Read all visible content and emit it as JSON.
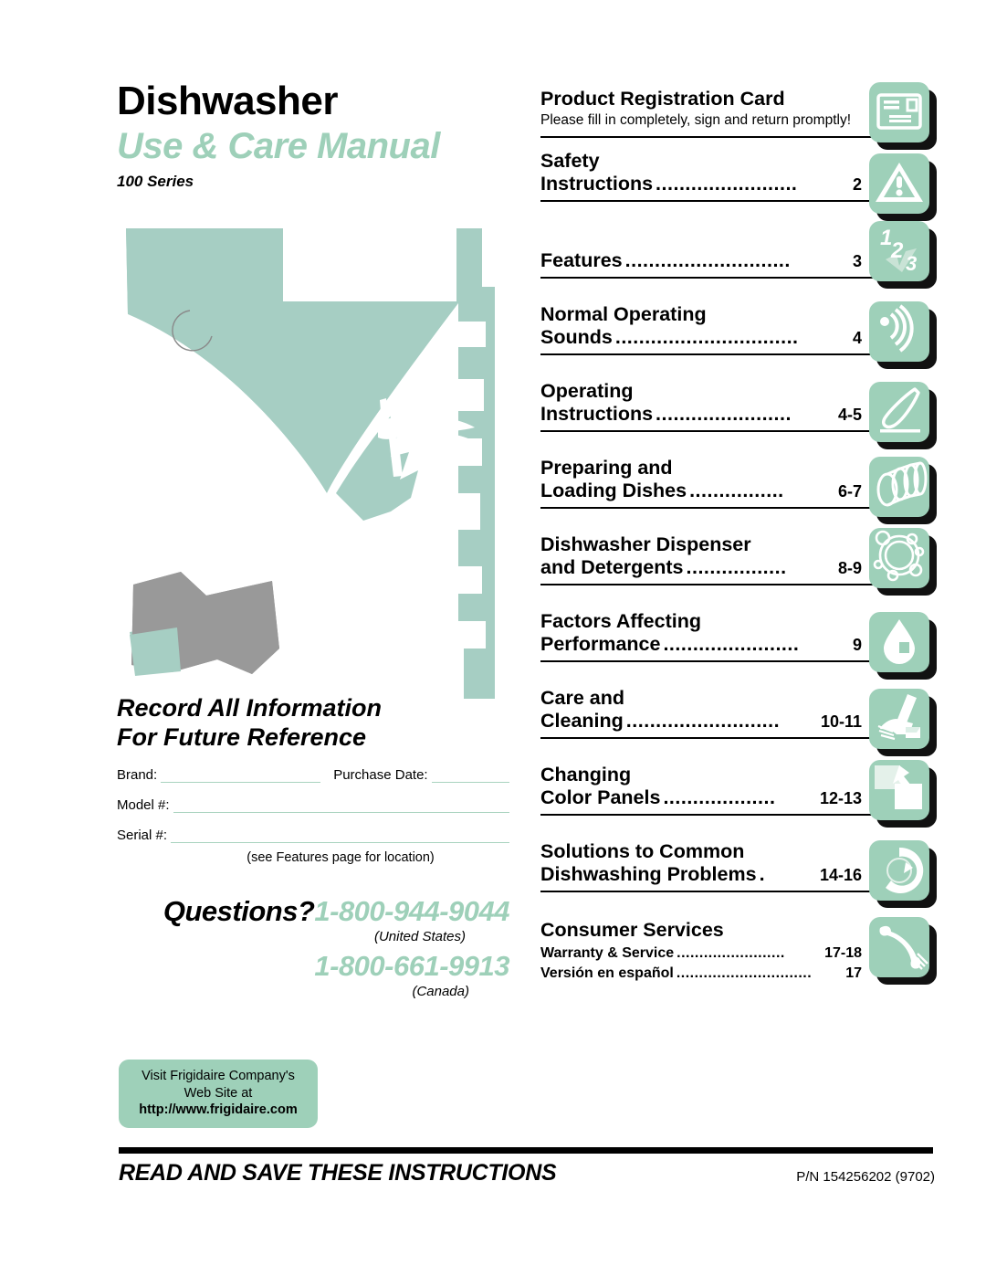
{
  "title": "Dishwasher",
  "subtitle": "Use & Care Manual",
  "series": "100 Series",
  "colors": {
    "mint": "#9ed0b9",
    "illustration_green": "#a6cec3",
    "illustration_gray": "#999999",
    "text": "#000000"
  },
  "illustration": {
    "name": "dishwasher-loading-illustration"
  },
  "record": {
    "heading_line1": "Record All Information",
    "heading_line2": "For Future Reference",
    "brand_label": "Brand:",
    "purchase_date_label": "Purchase Date:",
    "model_label": "Model #:",
    "serial_label": "Serial #:",
    "note": "(see Features page for location)"
  },
  "questions": {
    "label": "Questions?",
    "phone_us": "1-800-944-9044",
    "region_us": "(United States)",
    "phone_ca": "1-800-661-9913",
    "region_ca": "(Canada)"
  },
  "website": {
    "line1": "Visit Frigidaire Company's",
    "line2": "Web Site at",
    "url": "http://www.frigidaire.com"
  },
  "toc": {
    "entries": [
      {
        "line1": "Product Registration Card",
        "note": "Please fill in completely, sign and return promptly!",
        "page": "",
        "icon": "registration-card-icon",
        "has_leader": false
      },
      {
        "line1": "Safety",
        "line2": "Instructions",
        "leader": "........................",
        "page": "2",
        "icon": "warning-triangle-icon"
      },
      {
        "line1": "",
        "line2": "Features",
        "leader": "............................",
        "page": "3",
        "icon": "numbers-123-icon"
      },
      {
        "line1": "Normal Operating",
        "line2": "Sounds",
        "leader": "...............................",
        "page": "4",
        "icon": "sound-waves-icon"
      },
      {
        "line1": "Operating",
        "line2": "Instructions",
        "leader": ".......................",
        "page": "4-5",
        "icon": "spoon-icon"
      },
      {
        "line1": "Preparing and",
        "line2": "Loading Dishes",
        "leader": "................",
        "page": "6-7",
        "icon": "stacked-plates-icon"
      },
      {
        "line1": "Dishwasher Dispenser",
        "line2": "and Detergents",
        "leader": ".................",
        "page": "8-9",
        "icon": "detergent-bubbles-icon"
      },
      {
        "line1": "Factors Affecting",
        "line2": "Performance",
        "leader": ".......................",
        "page": "9",
        "icon": "water-drop-icon"
      },
      {
        "line1": "Care and",
        "line2": "Cleaning",
        "leader": "..........................",
        "page": "10-11",
        "icon": "hand-sponge-icon"
      },
      {
        "line1": "Changing",
        "line2": "Color Panels",
        "leader": "...................",
        "page": "12-13",
        "icon": "color-panels-icon"
      },
      {
        "line1": "Solutions  to Common",
        "line2": "Dishwashing Problems",
        "leader": ".",
        "page": "14-16",
        "icon": "troubleshooting-circle-icon"
      }
    ],
    "consumer": {
      "heading": "Consumer Services",
      "icon": "phone-handset-icon",
      "subs": [
        {
          "label": "Warranty & Service",
          "leader": "........................",
          "page": "17-18"
        },
        {
          "label": "Versión en español",
          "leader": "..............................",
          "page": "17"
        }
      ]
    }
  },
  "footer": {
    "instruction": "READ AND SAVE THESE INSTRUCTIONS",
    "part_number": "P/N 154256202 (9702)"
  }
}
